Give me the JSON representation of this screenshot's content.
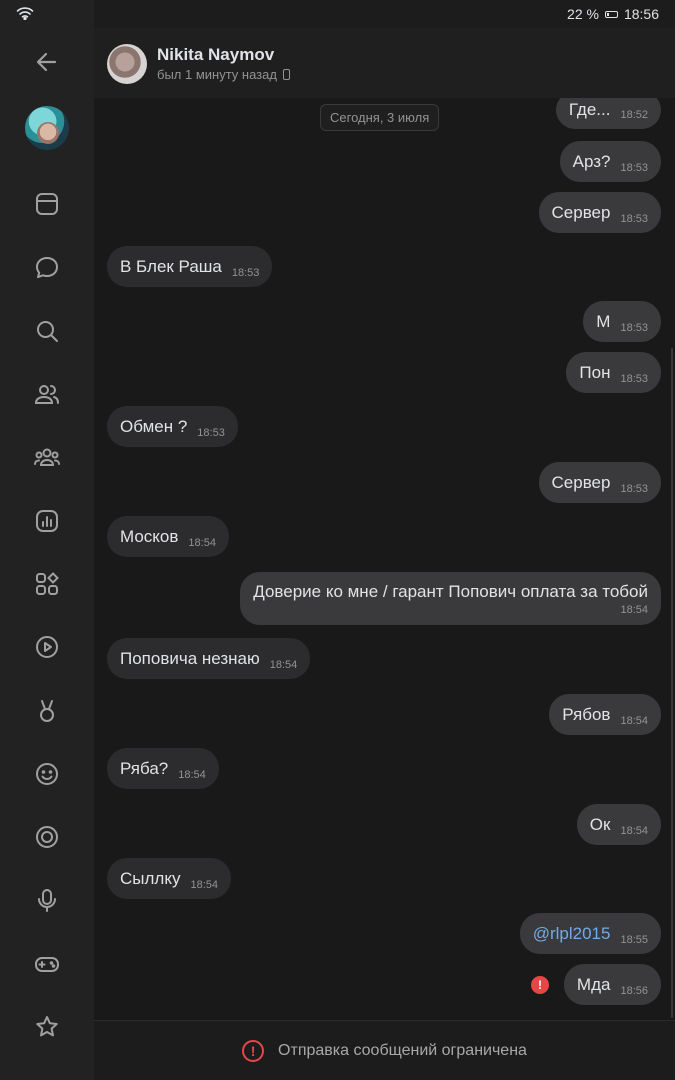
{
  "status_bar": {
    "battery": "22 %",
    "time": "18:56"
  },
  "header": {
    "name": "Nikita Naymov",
    "status": "был 1 минуту назад"
  },
  "chat": {
    "date": "Сегодня, 3 июля",
    "messages": [
      {
        "text": "Где...",
        "time": "18:52",
        "dir": "out"
      },
      {
        "text": "Арз?",
        "time": "18:53",
        "dir": "out"
      },
      {
        "text": "Сервер",
        "time": "18:53",
        "dir": "out"
      },
      {
        "text": "В Блек Раша",
        "time": "18:53",
        "dir": "in"
      },
      {
        "text": "М",
        "time": "18:53",
        "dir": "out"
      },
      {
        "text": "Пон",
        "time": "18:53",
        "dir": "out"
      },
      {
        "text": "Обмен ?",
        "time": "18:53",
        "dir": "in"
      },
      {
        "text": "Сервер",
        "time": "18:53",
        "dir": "out"
      },
      {
        "text": "Москов",
        "time": "18:54",
        "dir": "in"
      },
      {
        "text": "Доверие ко мне / гарант Попович оплата за тобой",
        "time": "18:54",
        "dir": "out"
      },
      {
        "text": "Поповича незнаю",
        "time": "18:54",
        "dir": "in"
      },
      {
        "text": "Рябов",
        "time": "18:54",
        "dir": "out"
      },
      {
        "text": "Ряба?",
        "time": "18:54",
        "dir": "in"
      },
      {
        "text": "Ок",
        "time": "18:54",
        "dir": "out"
      },
      {
        "text": "Сыллку",
        "time": "18:54",
        "dir": "in"
      },
      {
        "text": "@rlpl2015",
        "time": "18:55",
        "dir": "out"
      },
      {
        "text": "Мда",
        "time": "18:56",
        "dir": "out",
        "error": true
      }
    ]
  },
  "footer": {
    "notice": "Отправка сообщений ограничена"
  },
  "sidebar": {
    "icons": [
      "back-icon",
      "profile-avatar",
      "news-icon",
      "messages-icon",
      "search-icon",
      "friends-icon",
      "communities-icon",
      "podcasts-icon",
      "services-icon",
      "video-icon",
      "clips-icon",
      "stickers-icon",
      "target-icon",
      "voice-icon",
      "games-icon",
      "favorites-icon"
    ]
  },
  "colors": {
    "accent": "#71aaeb",
    "error": "#e64646",
    "bubble_out": "#3a3a3c",
    "bubble_in": "#2c2c2e"
  }
}
